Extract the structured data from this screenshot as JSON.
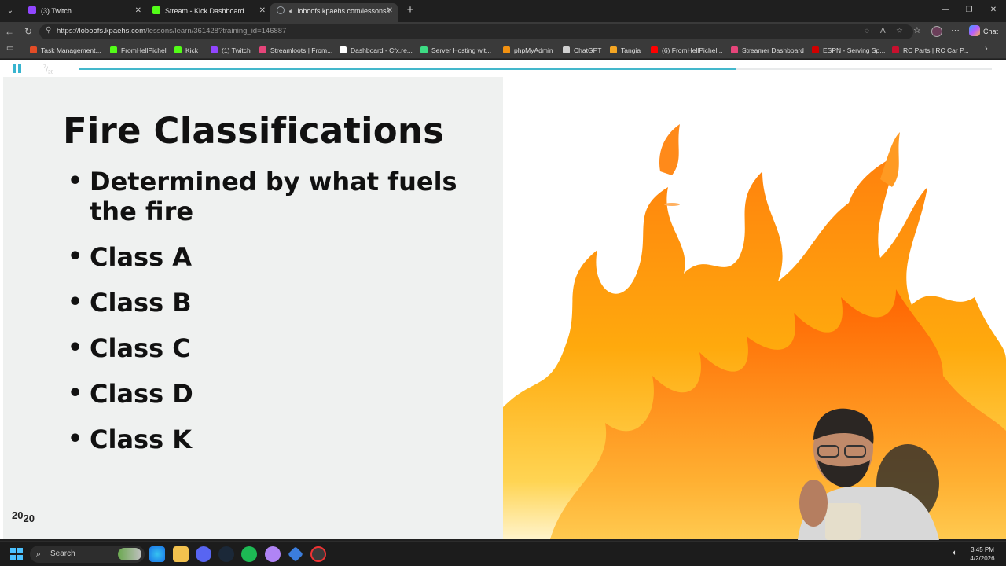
{
  "browser": {
    "tabs": [
      {
        "label": "(3) Twitch",
        "favicon_color": "#9146ff"
      },
      {
        "label": "Stream - Kick Dashboard",
        "favicon_color": "#53fc18"
      },
      {
        "label": "loboofs.kpaehs.com/lessons/l",
        "favicon_color": "#9aa0a6",
        "active": true
      }
    ],
    "new_tab": "+",
    "url_host": "https://loboofs.kpaehs.com",
    "url_path": "/lessons/learn/361428?training_id=146887",
    "copilot_label": "Chat",
    "bookmarks": [
      {
        "label": "Task Management...",
        "color": "#e34c26"
      },
      {
        "label": "FromHellPichel",
        "color": "#53fc18"
      },
      {
        "label": "Kick",
        "color": "#53fc18"
      },
      {
        "label": "(1) Twitch",
        "color": "#9146ff"
      },
      {
        "label": "Streamloots | From...",
        "color": "#e6457a"
      },
      {
        "label": "Dashboard - Cfx.re...",
        "color": "#ffffff"
      },
      {
        "label": "Server Hosting wit...",
        "color": "#3ddc84"
      },
      {
        "label": "phpMyAdmin",
        "color": "#f29111"
      },
      {
        "label": "ChatGPT",
        "color": "#d0d0d0"
      },
      {
        "label": "Tangia",
        "color": "#f5a623"
      },
      {
        "label": "(6) FromHellPichel...",
        "color": "#ff0000"
      },
      {
        "label": "Streamer Dashboard",
        "color": "#e6457a"
      },
      {
        "label": "ESPN - Serving Sp...",
        "color": "#d00000"
      },
      {
        "label": "RC Parts | RC Car P...",
        "color": "#c8102e"
      }
    ]
  },
  "player": {
    "slide_current": "7",
    "slide_total": "28",
    "progress_fraction": 0.72
  },
  "slide": {
    "title": "Fire Classifications",
    "bullets": [
      "Determined by what fuels the fire",
      "Class A",
      "Class B",
      "Class C",
      "Class D",
      "Class K"
    ],
    "logo_top": "20",
    "logo_bottom": "20"
  },
  "taskbar": {
    "search_placeholder": "Search",
    "time": "3:45 PM",
    "date": "4/2/2026"
  }
}
